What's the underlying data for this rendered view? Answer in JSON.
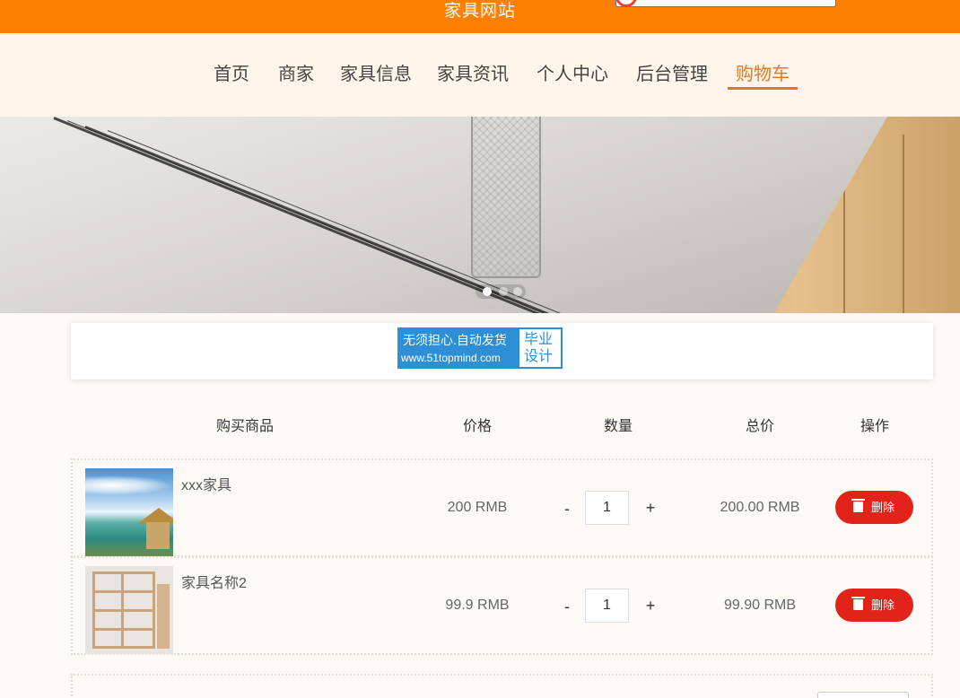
{
  "header": {
    "site_title": "家具网站"
  },
  "nav": {
    "items": [
      {
        "label": "首页"
      },
      {
        "label": "商家"
      },
      {
        "label": "家具信息"
      },
      {
        "label": "家具资讯"
      },
      {
        "label": "个人中心"
      },
      {
        "label": "后台管理"
      },
      {
        "label": "购物车"
      }
    ],
    "active_index": 6
  },
  "banner": {
    "slide_count": 3,
    "active_slide": 0
  },
  "ad": {
    "line1": "无须担心.自动发货",
    "line2": "www.51topmind.com",
    "right1": "毕业",
    "right2": "设计"
  },
  "cart": {
    "headers": {
      "product": "购买商品",
      "price": "价格",
      "quantity": "数量",
      "total": "总价",
      "action": "操作"
    },
    "rows": [
      {
        "name": "xxx家具",
        "price": "200 RMB",
        "qty": "1",
        "total": "200.00 RMB",
        "delete_label": "删除",
        "minus": "-",
        "plus": "+"
      },
      {
        "name": "家具名称2",
        "price": "99.9 RMB",
        "qty": "1",
        "total": "99.90 RMB",
        "delete_label": "删除",
        "minus": "-",
        "plus": "+"
      }
    ]
  },
  "colors": {
    "brand_orange": "#ff8000",
    "active_nav": "#e8761a",
    "delete_red": "#e2231a",
    "ad_blue": "#2d8fd5"
  }
}
